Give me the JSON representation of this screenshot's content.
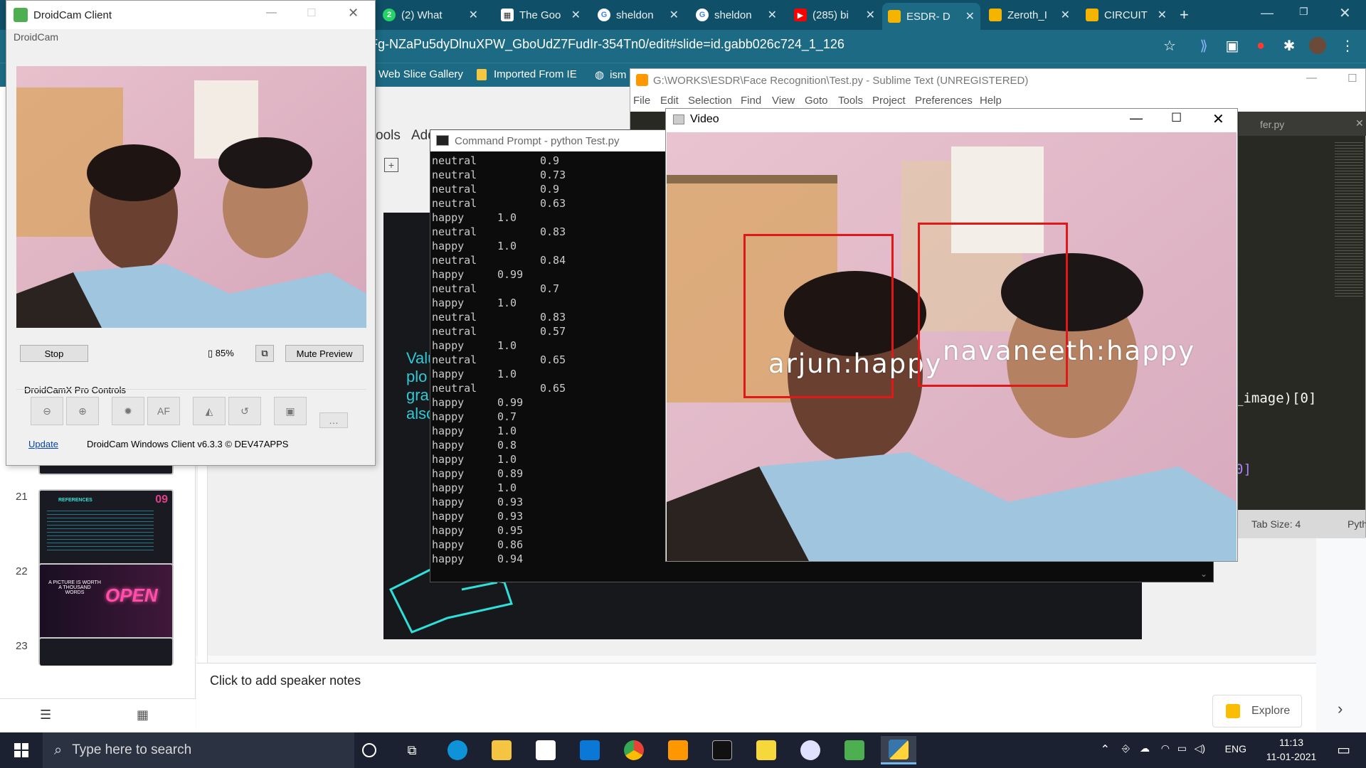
{
  "browser": {
    "tabs": [
      {
        "label": "(2) What",
        "icon": "whatsapp-icon",
        "color": "#25d366"
      },
      {
        "label": "The Goo",
        "icon": "page-icon",
        "color": "#ffffff"
      },
      {
        "label": "sheldon",
        "icon": "google-icon",
        "color": "#4285f4"
      },
      {
        "label": "sheldon",
        "icon": "google-icon",
        "color": "#4285f4"
      },
      {
        "label": "(285) bi",
        "icon": "youtube-icon",
        "color": "#ff0000"
      },
      {
        "label": "ESDR- D",
        "icon": "slides-icon",
        "color": "#f4b400"
      },
      {
        "label": "Zeroth_I",
        "icon": "slides-icon",
        "color": "#f4b400"
      },
      {
        "label": "CIRCUIT",
        "icon": "slides-icon",
        "color": "#f4b400"
      }
    ],
    "url": "Fg-NZaPu5dyDlnuXPW_GboUdZ7FudIr-354Tn0/edit#slide=id.gabb026c724_1_126",
    "bookmarks": [
      "Web Slice Gallery",
      "Imported From IE",
      "ism"
    ]
  },
  "slides": {
    "menu_partial": [
      "ools",
      "Add"
    ],
    "filmstrip": [
      {
        "num": "21",
        "title": "REFERENCES",
        "badge": "09"
      },
      {
        "num": "22",
        "title": "A PICTURE IS WORTH A THOUSAND WORDS",
        "neon": "OPEN"
      },
      {
        "num": "23"
      }
    ],
    "slide_text": [
      "Valu",
      "plo",
      "grap",
      "also"
    ],
    "speaker_notes": "Click to add speaker notes",
    "explore": "Explore"
  },
  "sublime": {
    "title": "G:\\WORKS\\ESDR\\Face Recognition\\Test.py - Sublime Text (UNREGISTERED)",
    "menu": [
      "File",
      "Edit",
      "Selection",
      "Find",
      "View",
      "Goto",
      "Tools",
      "Project",
      "Preferences",
      "Help"
    ],
    "tab": "fer.py",
    "code_fragments": [
      "_image)[0]",
      "0]"
    ],
    "status": {
      "tab_size": "Tab Size: 4",
      "syntax": "Pyth"
    }
  },
  "cmd": {
    "title": "Command Prompt - python  Test.py",
    "lines": [
      {
        "label": "neutral",
        "value": "0.9"
      },
      {
        "label": "neutral",
        "value": "0.73"
      },
      {
        "label": "neutral",
        "value": "0.9"
      },
      {
        "label": "neutral",
        "value": "0.63"
      },
      {
        "label": "happy",
        "value": "1.0"
      },
      {
        "label": "neutral",
        "value": "0.83"
      },
      {
        "label": "happy",
        "value": "1.0"
      },
      {
        "label": "neutral",
        "value": "0.84"
      },
      {
        "label": "happy",
        "value": "0.99"
      },
      {
        "label": "neutral",
        "value": "0.7"
      },
      {
        "label": "happy",
        "value": "1.0"
      },
      {
        "label": "neutral",
        "value": "0.83"
      },
      {
        "label": "neutral",
        "value": "0.57"
      },
      {
        "label": "happy",
        "value": "1.0"
      },
      {
        "label": "neutral",
        "value": "0.65"
      },
      {
        "label": "happy",
        "value": "1.0"
      },
      {
        "label": "neutral",
        "value": "0.65"
      },
      {
        "label": "happy",
        "value": "0.99"
      },
      {
        "label": "happy",
        "value": "0.7"
      },
      {
        "label": "happy",
        "value": "1.0"
      },
      {
        "label": "happy",
        "value": "0.8"
      },
      {
        "label": "happy",
        "value": "1.0"
      },
      {
        "label": "happy",
        "value": "0.89"
      },
      {
        "label": "happy",
        "value": "1.0"
      },
      {
        "label": "happy",
        "value": "0.93"
      },
      {
        "label": "happy",
        "value": "0.93"
      },
      {
        "label": "happy",
        "value": "0.95"
      },
      {
        "label": "happy",
        "value": "0.86"
      },
      {
        "label": "happy",
        "value": "0.94"
      }
    ]
  },
  "video": {
    "title": "Video",
    "faces": [
      {
        "label": "arjun:happy"
      },
      {
        "label": "navaneeth:happy"
      }
    ]
  },
  "droidcam": {
    "title": "DroidCam Client",
    "subtitle": "DroidCam",
    "stop": "Stop",
    "battery": "85%",
    "mute": "Mute Preview",
    "pro_controls": "DroidCamX Pro Controls",
    "af": "AF",
    "update": "Update",
    "version": "DroidCam Windows Client v6.3.3 © DEV47APPS"
  },
  "taskbar": {
    "search_placeholder": "Type here to search",
    "lang": "ENG",
    "time": "11:13",
    "date": "11-01-2021"
  },
  "colors": {
    "chrome_dark": "#0f4f67",
    "chrome_toolbar": "#1c6a84",
    "face_box": "#e01818",
    "taskbar": "#1b2130"
  }
}
